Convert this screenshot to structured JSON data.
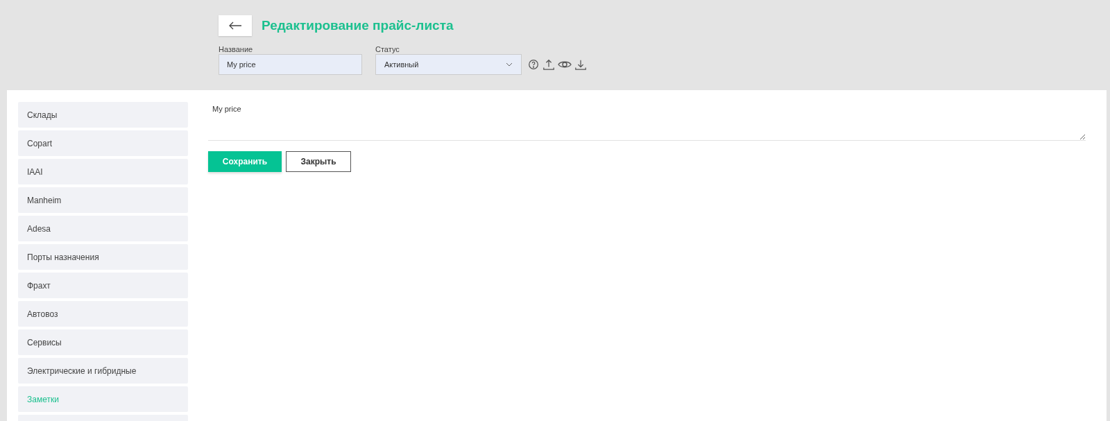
{
  "header": {
    "title": "Редактирование прайс-листа"
  },
  "fields": {
    "name": {
      "label": "Название",
      "value": "My price"
    },
    "status": {
      "label": "Статус",
      "value": "Активный"
    }
  },
  "sidebar": {
    "items": [
      {
        "label": "Склады",
        "selected": false
      },
      {
        "label": "Copart",
        "selected": false
      },
      {
        "label": "IAAI",
        "selected": false
      },
      {
        "label": "Manheim",
        "selected": false
      },
      {
        "label": "Adesa",
        "selected": false
      },
      {
        "label": "Порты назначения",
        "selected": false
      },
      {
        "label": "Фрахт",
        "selected": false
      },
      {
        "label": "Автовоз",
        "selected": false
      },
      {
        "label": "Сервисы",
        "selected": false
      },
      {
        "label": "Электрические и гибридные",
        "selected": false
      },
      {
        "label": "Заметки",
        "selected": true
      }
    ]
  },
  "notes": {
    "value": "My price"
  },
  "buttons": {
    "save": "Сохранить",
    "close": "Закрыть"
  }
}
